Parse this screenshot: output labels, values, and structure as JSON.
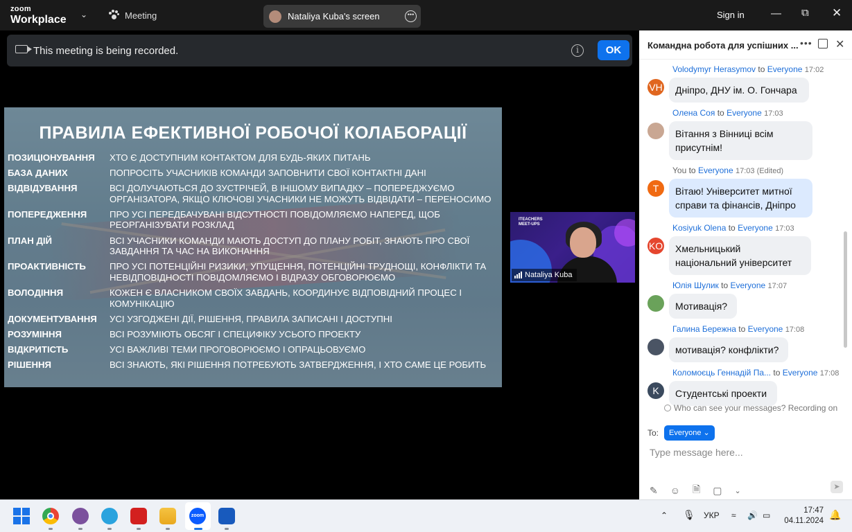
{
  "topbar": {
    "logo_small": "zoom",
    "logo_big": "Workplace",
    "meeting_label": "Meeting",
    "screen_label": "Nataliya Kuba's screen",
    "sign_in": "Sign in"
  },
  "banner": {
    "text": "This meeting is being recorded.",
    "ok": "OK"
  },
  "slide": {
    "title": "ПРАВИЛА ЕФЕКТИВНОЇ  РОБОЧОЇ КОЛАБОРАЦІЇ",
    "rows": [
      {
        "k": "ПОЗИЦІОНУВАННЯ",
        "v": "ХТО Є ДОСТУПНИМ КОНТАКТОМ ДЛЯ БУДЬ-ЯКИХ ПИТАНЬ"
      },
      {
        "k": "БАЗА ДАНИХ",
        "v": "ПОПРОСІТЬ УЧАСНИКІВ КОМАНДИ ЗАПОВНИТИ СВОЇ КОНТАКТНІ ДАНІ"
      },
      {
        "k": "ВІДВІДУВАННЯ",
        "v": "ВСІ ДОЛУЧАЮТЬСЯ ДО ЗУСТРІЧЕЙ, В ІНШОМУ ВИПАДКУ – ПОПЕРЕДЖУЄМО ОРГАНІЗАТОРА, ЯКЩО КЛЮЧОВІ УЧАСНИКИ НЕ МОЖУТЬ ВІДВІДАТИ – ПЕРЕНОСИМО"
      },
      {
        "k": "ПОПЕРЕДЖЕННЯ",
        "v": "ПРО УСІ ПЕРЕДБАЧУВАНІ ВІДСУТНОСТІ ПОВІДОМЛЯЄМО НАПЕРЕД, ЩОБ РЕОРГАНІЗУВАТИ РОЗКЛАД"
      },
      {
        "k": "ПЛАН ДІЙ",
        "v": "ВСІ УЧАСНИКИ КОМАНДИ МАЮТЬ ДОСТУП ДО ПЛАНУ РОБІТ, ЗНАЮТЬ ПРО СВОЇ ЗАВДАННЯ ТА ЧАС НА ВИКОНАННЯ"
      },
      {
        "k": "ПРОАКТИВНІСТЬ",
        "v": "ПРО УСІ ПОТЕНЦІЙНІ РИЗИКИ, УПУЩЕННЯ, ПОТЕНЦІЙНІ ТРУДНОЩІ, КОНФЛІКТИ ТА НЕВІДПОВІДНОСТІ ПОВІДОМЛЯЄМО І ВІДРАЗУ ОБГОВОРЮЄМО"
      },
      {
        "k": "ВОЛОДІННЯ",
        "v": "КОЖЕН Є ВЛАСНИКОМ СВОЇХ ЗАВДАНЬ, КООРДИНУЄ ВІДПОВІДНИЙ ПРОЦЕС І КОМУНІКАЦІЮ"
      },
      {
        "k": "ДОКУМЕНТУВАННЯ",
        "v": "УСІ УЗГОДЖЕНІ ДІЇ, РІШЕННЯ, ПРАВИЛА ЗАПИСАНІ І ДОСТУПНІ"
      },
      {
        "k": "РОЗУМІННЯ",
        "v": "ВСІ РОЗУМІЮТЬ ОБСЯГ І СПЕЦИФІКУ УСЬОГО ПРОЕКТУ"
      },
      {
        "k": "ВІДКРИТІСТЬ",
        "v": "УСІ ВАЖЛИВІ ТЕМИ ПРОГОВОРЮЄМО І ОПРАЦЬОВУЄМО"
      },
      {
        "k": "РІШЕННЯ",
        "v": "ВСІ ЗНАЮТЬ, ЯКІ РІШЕННЯ ПОТРЕБУЮТЬ ЗАТВЕРДЖЕННЯ, І ХТО САМЕ ЦЕ РОБИТЬ"
      }
    ]
  },
  "video": {
    "name": "Nataliya Kuba",
    "badge_line1": "ITEACHERS",
    "badge_line2": "MEET-UPS"
  },
  "chat": {
    "title": "Командна робота для успішних ...",
    "messages": [
      {
        "sender": "Volodymyr Herasymov",
        "to": "to",
        "target": "Everyone",
        "time": "17:02",
        "initials": "VH",
        "color": "#e0661f",
        "text": "Дніпро, ДНУ ім. О. Гончара"
      },
      {
        "sender": "Олена Соя",
        "to": "to",
        "target": "Everyone",
        "time": "17:03",
        "initials": "",
        "color": "#c9a793",
        "text": "Вітання з Вінниці всім присутнім!"
      },
      {
        "sender": "You",
        "to": "to",
        "target": "Everyone",
        "time": "17:03 (Edited)",
        "initials": "T",
        "color": "#f06a12",
        "text": "Вітаю! Університет митної справи та фінансів, Дніпро"
      },
      {
        "sender": "Kosiyuk Olena",
        "to": "to",
        "target": "Everyone",
        "time": "17:03",
        "initials": "KO",
        "color": "#e5462e",
        "text": "Хмельницький національний університет"
      },
      {
        "sender": "Юлія Шулик",
        "to": "to",
        "target": "Everyone",
        "time": "17:07",
        "initials": "",
        "color": "#6aa25a",
        "text": "Мотивація?"
      },
      {
        "sender": "Галина Бережна",
        "to": "to",
        "target": "Everyone",
        "time": "17:08",
        "initials": "",
        "color": "#4a5464",
        "text": "мотивація? конфлікти?"
      },
      {
        "sender": "Коломоєць Геннадій Па...",
        "to": "to",
        "target": "Everyone",
        "time": "17:08",
        "initials": "K",
        "color": "#3b4a5e",
        "text": "Студентські проекти"
      }
    ],
    "who_can_see": "Who can see your messages? Recording on",
    "to_label": "To:",
    "to_value": "Everyone",
    "placeholder": "Type message here..."
  },
  "taskbar": {
    "lang": "УКР",
    "time": "17:47",
    "date": "04.11.2024",
    "zoom_label": "zoom"
  }
}
